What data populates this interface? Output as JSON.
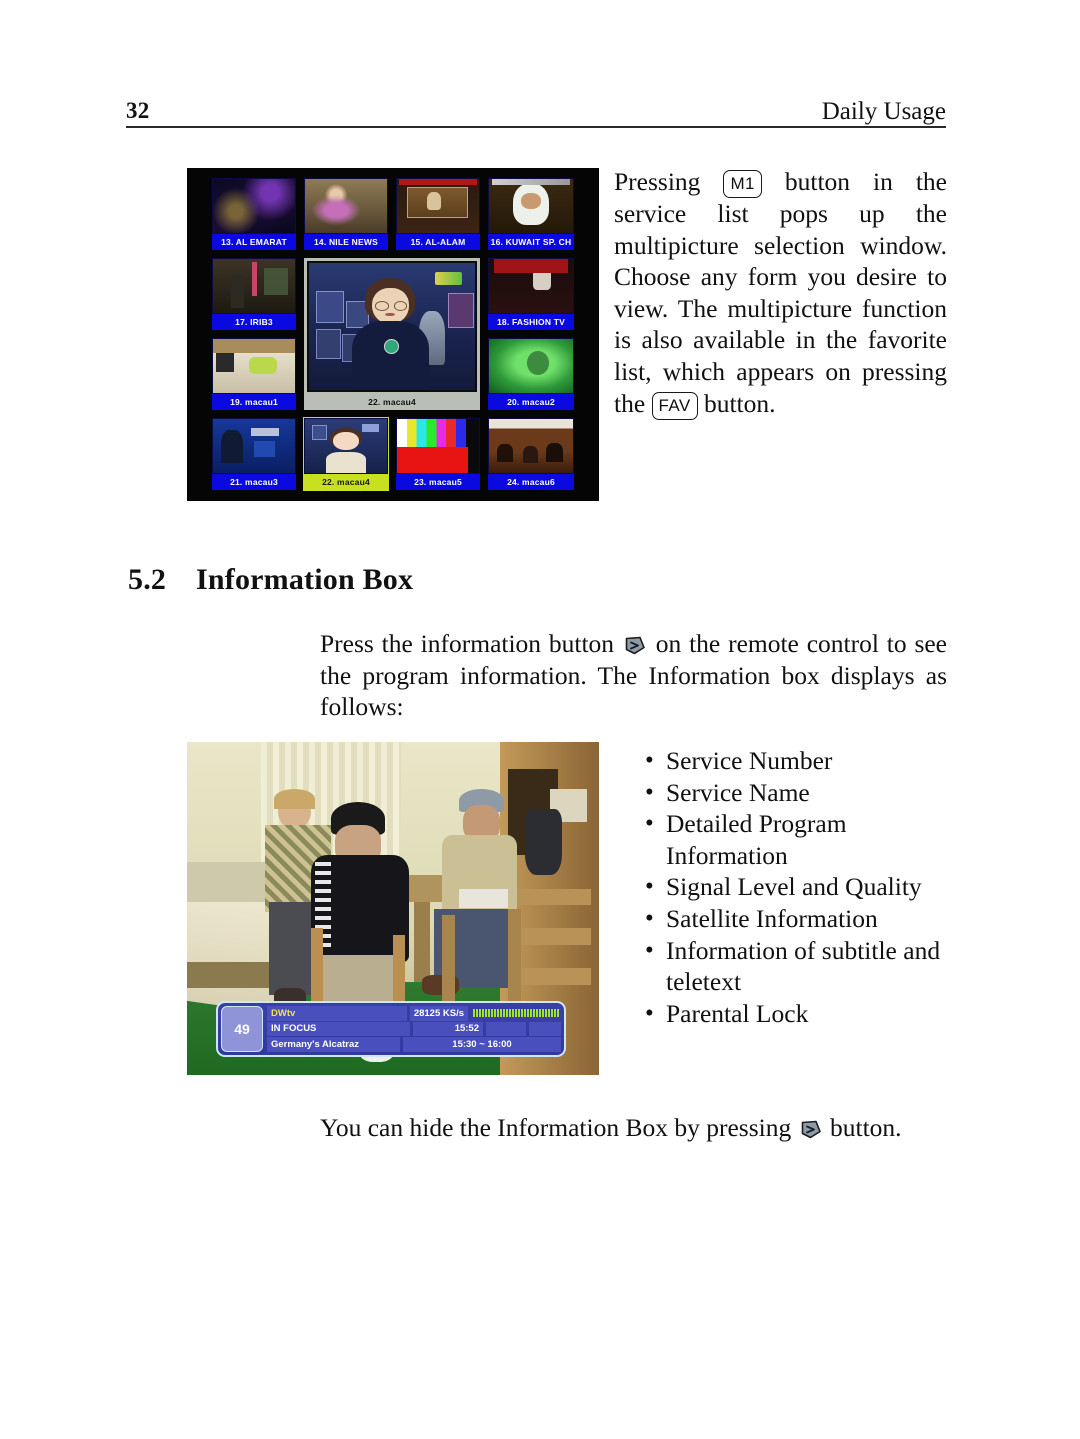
{
  "header": {
    "page_number": "32",
    "title": "Daily Usage"
  },
  "top_paragraph": {
    "part1": "Pressing",
    "key1": "M1",
    "part2": "button in the service list pops up the multipicture selection window. Choose any form you desire to view. The multipicture function is also available in the favorite list, which appears on pressing the",
    "key2": "FAV",
    "part3": "button."
  },
  "multipicture_screenshot": {
    "alt": "multipicture-selection-window",
    "tiles": [
      {
        "label": "13. AL EMARAT",
        "scene": "night-club"
      },
      {
        "label": "14. NILE NEWS",
        "scene": "news-anchor-pink"
      },
      {
        "label": "15. AL-ALAM",
        "scene": "news-studio"
      },
      {
        "label": "16. KUWAIT SP. CH",
        "scene": "man-headscarf"
      },
      {
        "label": "17. IRIB3",
        "scene": "dark-interior"
      },
      {
        "label": "18. FASHION TV",
        "scene": "fashion-runway"
      },
      {
        "label": "19. macau1",
        "scene": "living-room"
      },
      {
        "label": "20. macau2",
        "scene": "green-underwater"
      },
      {
        "label": "21. macau3",
        "scene": "blue-quiz-show"
      },
      {
        "label": "22. macau4",
        "scene": "anime-girl"
      },
      {
        "label": "23. macau5",
        "scene": "color-bars"
      },
      {
        "label": "24. macau6",
        "scene": "crowd"
      }
    ],
    "selected_big": {
      "label": "22. macau4",
      "scene": "anime-woman"
    },
    "selected_small_label": "22. macau4"
  },
  "section": {
    "number": "5.2",
    "title": "Information Box"
  },
  "info_paragraph": {
    "part1": "Press the information button",
    "icon": "info-remote-button-icon",
    "part2": "on the remote control to see the program information. The Information box displays as follows:"
  },
  "bullets": [
    "Service Number",
    "Service Name",
    "Detailed Program Information",
    "Signal Level and Quality",
    "Satellite Information",
    "Information of subtitle and teletext",
    "Parental Lock"
  ],
  "bullet_marker": "•",
  "tv_screenshot": {
    "alt": "information-box-on-screen-display",
    "osd": {
      "service_number": "49",
      "service_name": "DWtv",
      "symbol_rate": "28125 KS/s",
      "signal_bar_label": "signal-level-bar",
      "program_title": "IN FOCUS",
      "clock": "15:52",
      "program_subtitle": "Germany's Alcatraz",
      "program_time": "15:30 ~ 16:00"
    }
  },
  "closing": {
    "part1": "You can hide the Information Box by pressing",
    "icon": "info-remote-button-icon",
    "part2": "button."
  },
  "colors": {
    "osd_blue": "#3a3fa8",
    "osd_cell": "#4a4fbe",
    "osd_border": "#cfe7f2",
    "channel_name_yellow": "#f2e34a",
    "signal_green": "#9ee33a",
    "caption_blue": "#0a0ae0",
    "highlight_yellow": "#c8e020",
    "selected_gray": "#b9bfb6",
    "text_black": "#111111"
  }
}
